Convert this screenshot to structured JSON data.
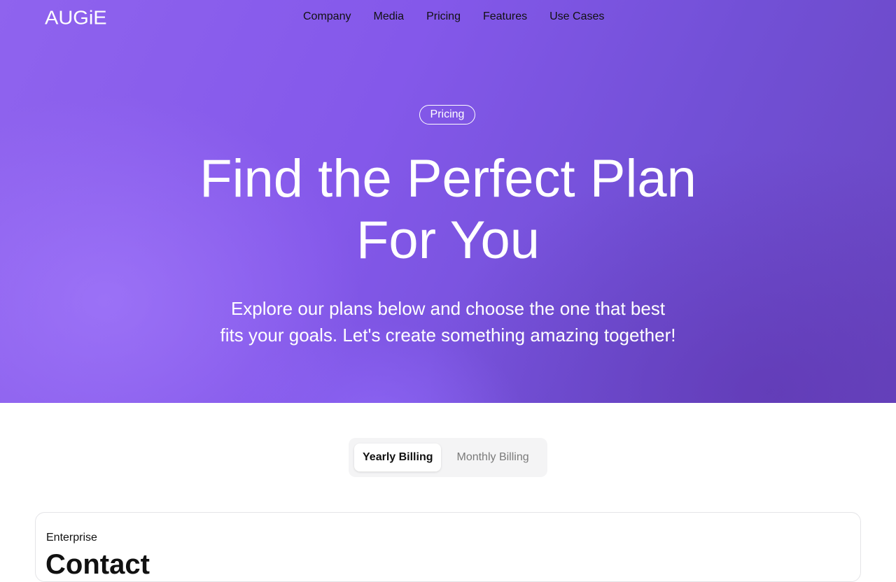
{
  "brand": {
    "logo_text": "AUGiE"
  },
  "nav": {
    "items": [
      "Company",
      "Media",
      "Pricing",
      "Features",
      "Use Cases"
    ]
  },
  "hero": {
    "badge": "Pricing",
    "headline_line1": "Find the Perfect Plan",
    "headline_line2": "For You",
    "subtitle_line1": "Explore our plans below and choose the one that best",
    "subtitle_line2": "fits your goals. Let's create something amazing together!"
  },
  "billing_toggle": {
    "yearly_label": "Yearly Billing",
    "monthly_label": "Monthly Billing",
    "selected": "Yearly Billing"
  },
  "plans": [
    {
      "name": "Enterprise",
      "price": "Contact"
    }
  ],
  "colors": {
    "hero_gradient_start": "#8f63ee",
    "hero_gradient_end": "#6a47c2",
    "toggle_bg": "#f4f4f5"
  }
}
